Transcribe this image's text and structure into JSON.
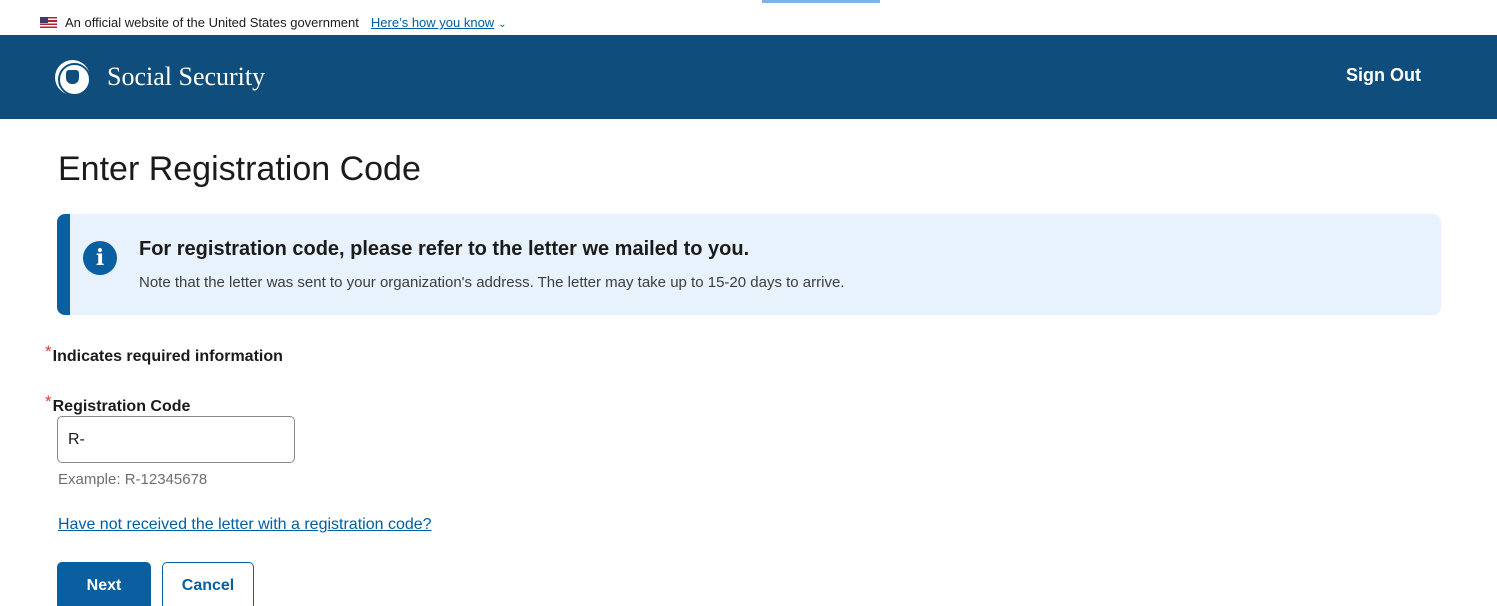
{
  "gov_banner": {
    "text": "An official website of the United States government",
    "link": "Here’s how you know",
    "chevron": "chevron-down-icon"
  },
  "header": {
    "brand": "Social Security",
    "sign_out": "Sign Out",
    "background": "#0f4d7c"
  },
  "page": {
    "title": "Enter Registration Code"
  },
  "alert": {
    "icon": "info-icon",
    "icon_glyph": "i",
    "title": "For registration code, please refer to the letter we mailed to you.",
    "text": "Note that the letter was sent to your organization's address. The letter may take up to 15-20 days to arrive.",
    "background": "#e7f2fd",
    "accent": "#0a5fa0"
  },
  "form": {
    "required_marker": "*",
    "required_note": "Indicates required information",
    "field_label": "Registration Code",
    "field_value": "R-",
    "hint": "Example: R-12345678",
    "help_link": "Have not received the letter with a registration code?"
  },
  "buttons": {
    "next": "Next",
    "cancel": "Cancel"
  },
  "colors": {
    "primary": "#0a5fa0",
    "required": "#d83933",
    "link": "#005ea2"
  }
}
